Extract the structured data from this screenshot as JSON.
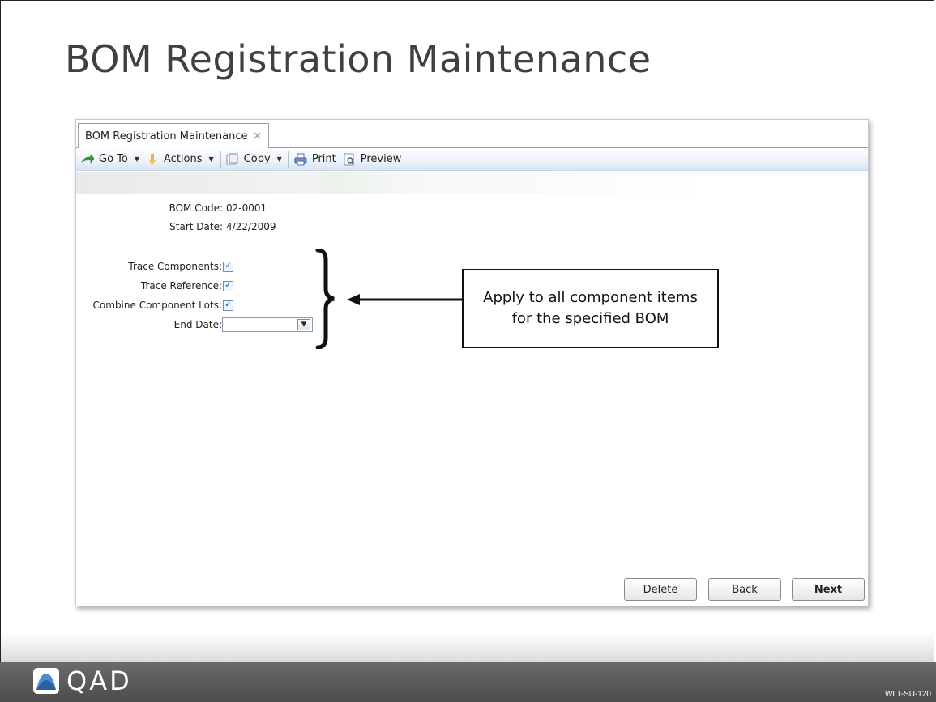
{
  "slide": {
    "title": "BOM Registration Maintenance",
    "footer_brand": "QAD",
    "slide_code": "WLT-SU-120"
  },
  "app": {
    "tab": {
      "label": "BOM Registration Maintenance",
      "close_glyph": "×"
    },
    "toolbar": {
      "items": [
        {
          "label": "Go To",
          "icon": "goto-arrow-icon",
          "dropdown": true
        },
        {
          "label": "Actions",
          "icon": "actions-flag-icon",
          "dropdown": true
        },
        {
          "label": "Copy",
          "icon": "copy-icon",
          "dropdown": true
        },
        {
          "label": "Print",
          "icon": "printer-icon",
          "dropdown": false
        },
        {
          "label": "Preview",
          "icon": "preview-icon",
          "dropdown": false
        }
      ]
    },
    "form": {
      "bom_code": {
        "label": "BOM Code:",
        "value": "02-0001"
      },
      "start_date": {
        "label": "Start Date:",
        "value": "4/22/2009"
      },
      "trace_components": {
        "label": "Trace Components:",
        "checked": true
      },
      "trace_reference": {
        "label": "Trace Reference:",
        "checked": true
      },
      "combine_component_lots": {
        "label": "Combine Component Lots:",
        "checked": true
      },
      "end_date": {
        "label": "End Date:",
        "value": ""
      }
    },
    "buttons": {
      "delete": "Delete",
      "back": "Back",
      "next": "Next"
    }
  },
  "annotation": {
    "callout_text": "Apply to all component items for the specified BOM"
  },
  "colors": {
    "footer": "#555555",
    "toolbar_gradient": "#d9e5f3",
    "title": "#404040"
  }
}
